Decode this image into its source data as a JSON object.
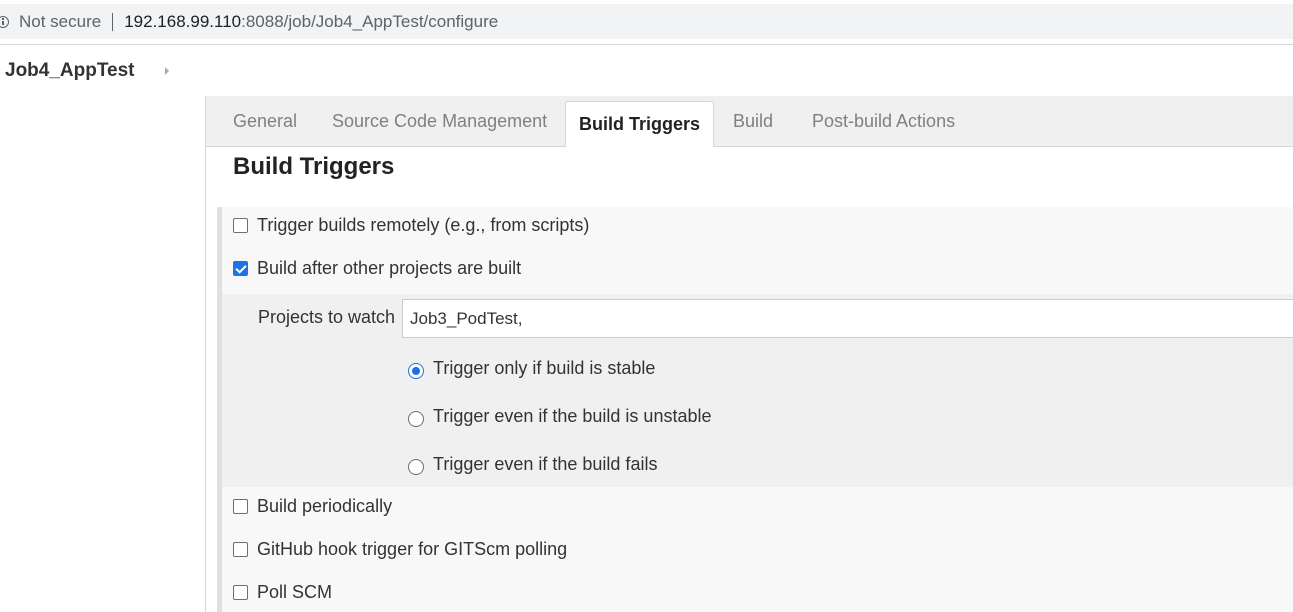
{
  "browser": {
    "security_label": "Not secure",
    "url_host": "192.168.99.110",
    "url_path": ":8088/job/Job4_AppTest/configure"
  },
  "breadcrumb": {
    "job_name": "Job4_AppTest"
  },
  "tabs": [
    {
      "label": "General",
      "active": false
    },
    {
      "label": "Source Code Management",
      "active": false
    },
    {
      "label": "Build Triggers",
      "active": true
    },
    {
      "label": "Build",
      "active": false
    },
    {
      "label": "Post-build Actions",
      "active": false
    }
  ],
  "section": {
    "title": "Build Triggers",
    "options": [
      {
        "label": "Trigger builds remotely (e.g., from scripts)",
        "checked": false
      },
      {
        "label": "Build after other projects are built",
        "checked": true
      },
      {
        "label": "Build periodically",
        "checked": false
      },
      {
        "label": "GitHub hook trigger for GITScm polling",
        "checked": false
      },
      {
        "label": "Poll SCM",
        "checked": false
      }
    ],
    "projects_to_watch": {
      "label": "Projects to watch",
      "value": "Job3_PodTest,"
    },
    "radios": [
      {
        "label": "Trigger only if build is stable",
        "selected": true
      },
      {
        "label": "Trigger even if the build is unstable",
        "selected": false
      },
      {
        "label": "Trigger even if the build fails",
        "selected": false
      }
    ]
  },
  "colors": {
    "accent": "#1a73e8",
    "tab_strip": "#f0f0f0",
    "section_bg": "#f8f8f8",
    "nested_bg": "#f0f0f0"
  }
}
